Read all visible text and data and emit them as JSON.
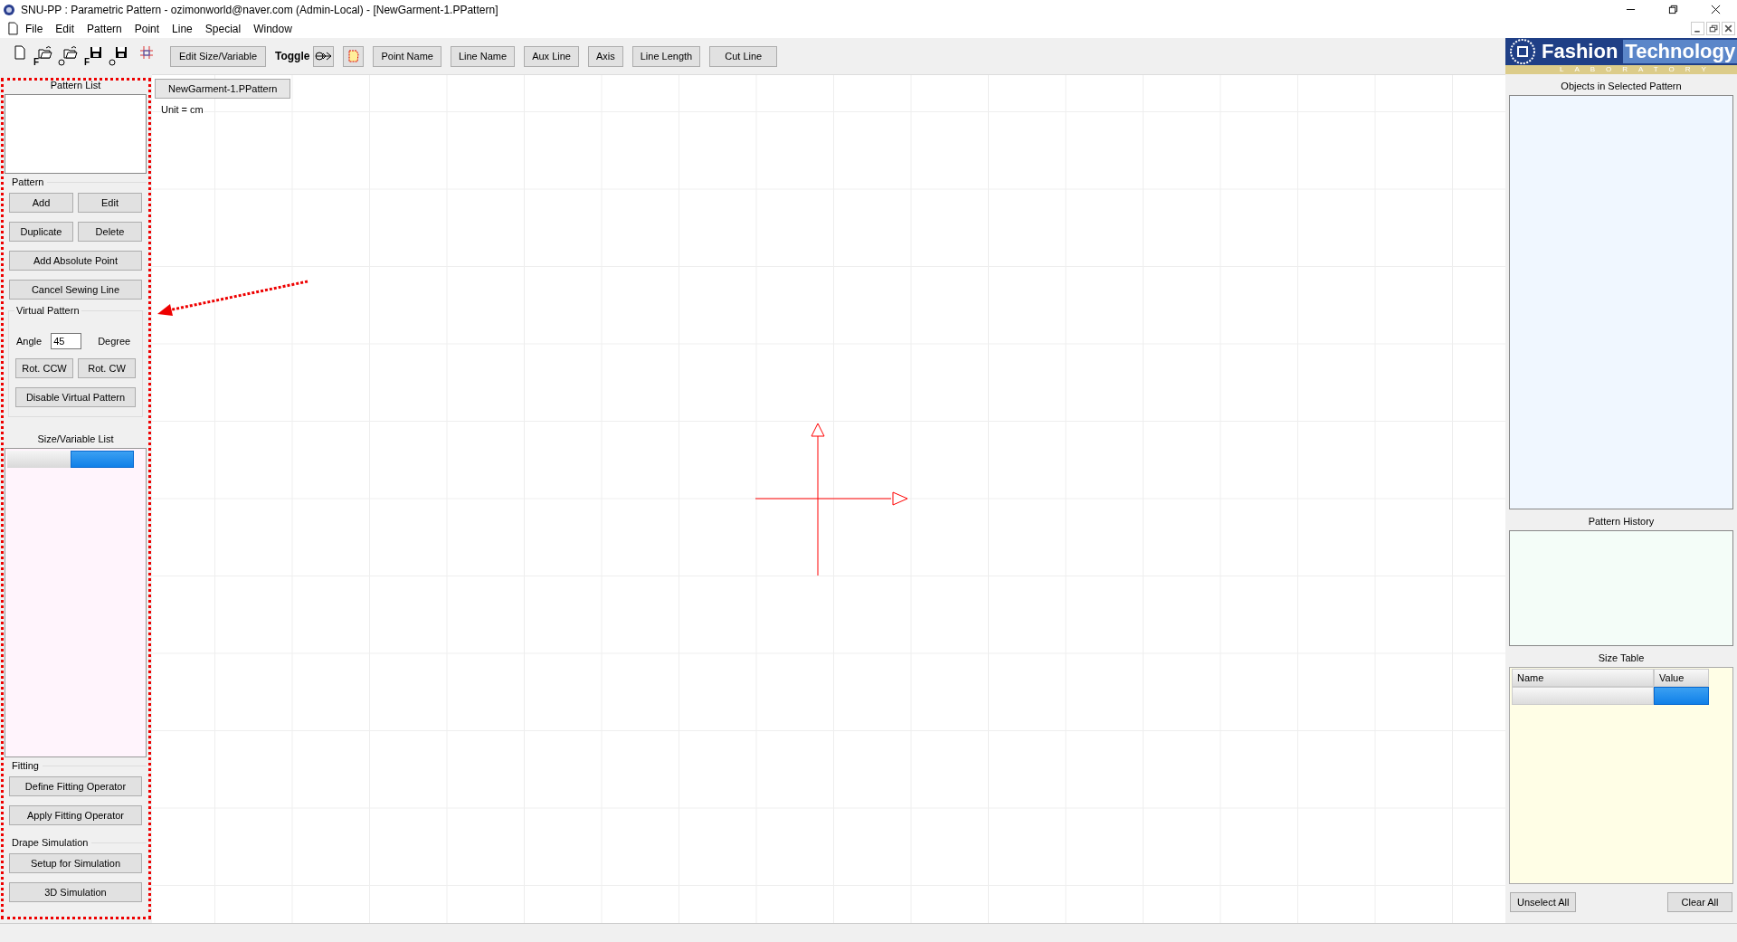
{
  "window": {
    "title": "SNU-PP : Parametric Pattern  - ozimonworld@naver.com (Admin-Local) - [NewGarment-1.PPattern]"
  },
  "menu": [
    "File",
    "Edit",
    "Pattern",
    "Point",
    "Line",
    "Special",
    "Window"
  ],
  "toolbar": {
    "tools": [
      {
        "kind": "new"
      },
      {
        "kind": "open",
        "letter": "F"
      },
      {
        "kind": "open",
        "circle": true
      },
      {
        "kind": "save",
        "letter": "F"
      },
      {
        "kind": "save",
        "circle": true
      },
      {
        "kind": "grid"
      }
    ],
    "edit_button": "Edit Size/Variable",
    "toggle_label": "Toggle",
    "toggles": [
      {
        "kind": "link"
      },
      {
        "kind": "shape"
      }
    ],
    "buttons": [
      "Point Name",
      "Line Name",
      "Aux Line",
      "Axis",
      "Line Length",
      "Cut Line"
    ]
  },
  "left_panel": {
    "pattern_list_title": "Pattern List",
    "pattern_group": "Pattern",
    "pattern_buttons": [
      [
        "Add",
        "Edit"
      ],
      [
        "Duplicate",
        "Delete"
      ],
      [
        "Add Absolute Point"
      ],
      [
        "Cancel Sewing Line"
      ]
    ],
    "virtual_group": "Virtual Pattern",
    "angle_label": "Angle",
    "angle_value": "45",
    "degree_label": "Degree",
    "rot_buttons": [
      "Rot. CCW",
      "Rot. CW"
    ],
    "disable_button": "Disable Virtual Pattern",
    "size_list_title": "Size/Variable List",
    "fitting_group": "Fitting",
    "fitting_buttons": [
      "Define Fitting Operator",
      "Apply Fitting Operator"
    ],
    "drape_group": "Drape Simulation",
    "drape_buttons": [
      "Setup for Simulation",
      "3D Simulation"
    ]
  },
  "canvas": {
    "tab": "NewGarment-1.PPattern",
    "unit": "Unit = cm"
  },
  "logo": {
    "left": "Fashion",
    "right": "Technology",
    "sub": "LABORATORY"
  },
  "right_panel": {
    "objects_title": "Objects in Selected Pattern",
    "history_title": "Pattern History",
    "size_table_title": "Size Table",
    "columns": [
      "Name",
      "Value"
    ],
    "buttons": [
      "Unselect All",
      "Clear All"
    ]
  }
}
